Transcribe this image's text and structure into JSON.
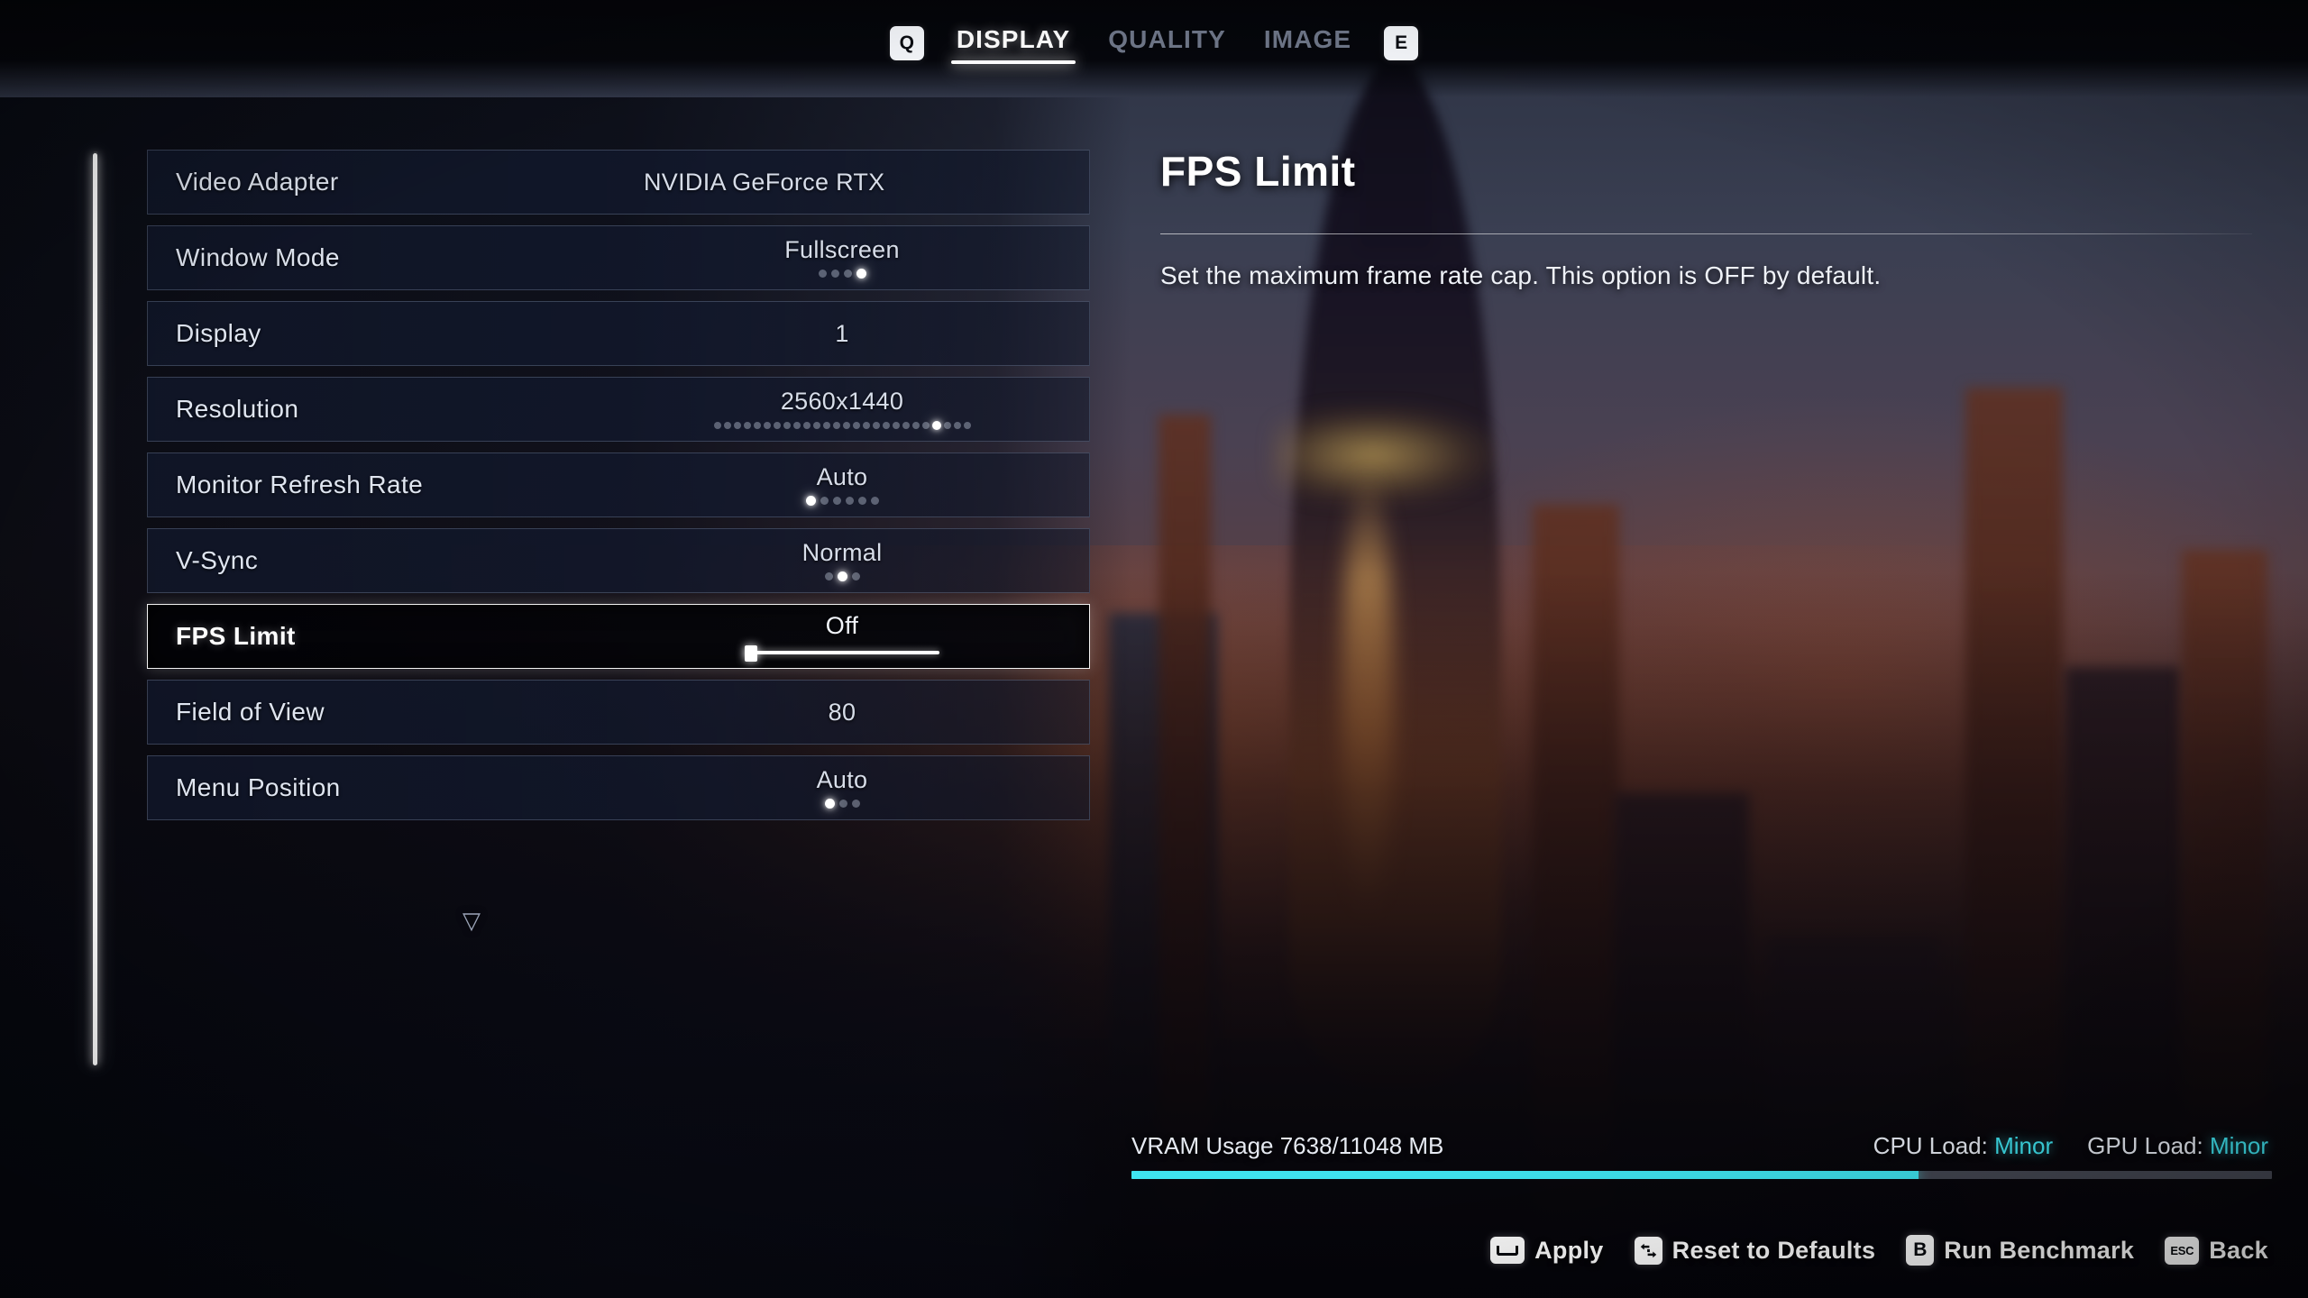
{
  "topbar": {
    "prev_key": "Q",
    "next_key": "E",
    "tabs": [
      {
        "label": "DISPLAY",
        "active": true
      },
      {
        "label": "QUALITY",
        "active": false
      },
      {
        "label": "IMAGE",
        "active": false
      }
    ]
  },
  "settings": {
    "scroll_more_glyph": "▽",
    "rows": [
      {
        "label": "Video Adapter",
        "value": "NVIDIA GeForce RTX ",
        "control": "text",
        "selected": false,
        "clipped": true
      },
      {
        "label": "Window Mode",
        "value": "Fullscreen",
        "control": "dots",
        "selected": false,
        "dots_total": 4,
        "dots_index": 3
      },
      {
        "label": "Display",
        "value": "1",
        "control": "text",
        "selected": false
      },
      {
        "label": "Resolution",
        "value": "2560x1440",
        "control": "dots",
        "selected": false,
        "dots_total": 26,
        "dots_index": 22
      },
      {
        "label": "Monitor Refresh Rate",
        "value": "Auto",
        "control": "dots",
        "selected": false,
        "dots_total": 6,
        "dots_index": 0
      },
      {
        "label": "V-Sync",
        "value": "Normal",
        "control": "dots",
        "selected": false,
        "dots_total": 3,
        "dots_index": 1
      },
      {
        "label": "FPS Limit",
        "value": "Off",
        "control": "slider",
        "selected": true,
        "slider_percent": 0
      },
      {
        "label": "Field of View",
        "value": "80",
        "control": "text",
        "selected": false
      },
      {
        "label": "Menu Position",
        "value": "Auto",
        "control": "dots",
        "selected": false,
        "dots_total": 3,
        "dots_index": 0
      }
    ]
  },
  "detail": {
    "title": "FPS Limit",
    "description": "Set the maximum frame rate cap. This option is OFF by default."
  },
  "performance": {
    "vram_text": "VRAM Usage 7638/11048 MB",
    "vram_used_mb": 7638,
    "vram_total_mb": 11048,
    "vram_percent": 69,
    "cpu_label": "CPU Load:",
    "cpu_value": "Minor",
    "gpu_label": "GPU Load:",
    "gpu_value": "Minor",
    "accent_color": "#3fe3ef"
  },
  "actions": [
    {
      "key": "space",
      "key_label": "",
      "label": "Apply"
    },
    {
      "key": "lr",
      "key_label": "↔",
      "label": "Reset to Defaults"
    },
    {
      "key": "b",
      "key_label": "B",
      "label": "Run Benchmark"
    },
    {
      "key": "esc",
      "key_label": "ESC",
      "label": "Back"
    }
  ]
}
